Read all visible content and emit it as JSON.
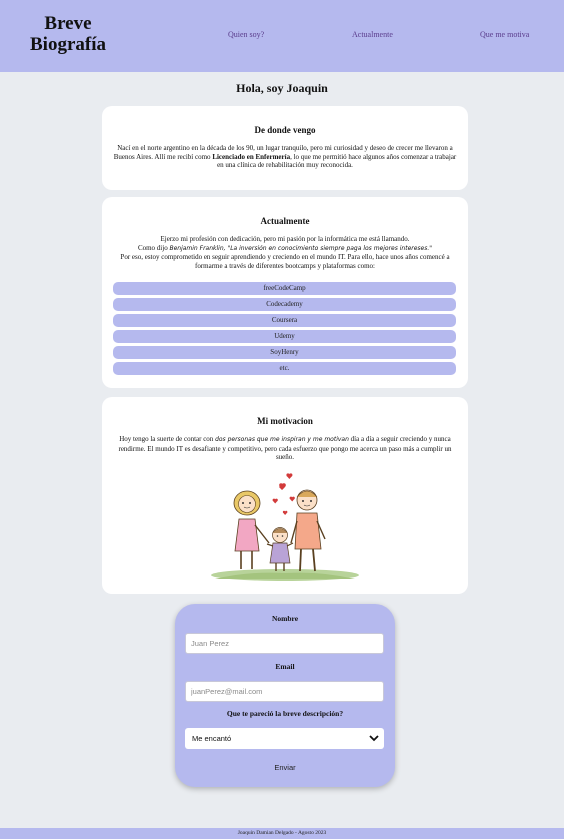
{
  "header": {
    "title": "Breve Biografía",
    "nav": [
      "Quien soy?",
      "Actualmente",
      "Que me motiva"
    ]
  },
  "greeting": "Hola, soy Joaquin",
  "origin": {
    "title": "De donde vengo",
    "text_before": "Nací en el norte argentino en la década de los 90, un lugar tranquilo, pero mi curiosidad y deseo de crecer me llevaron a Buenos Aires. Allí me recibí como ",
    "highlight": "Licenciado en Enfermería",
    "text_after": ", lo que me permitió hace algunos años comenzar a trabajar en una clínica de rehabilitación muy reconocida."
  },
  "current": {
    "title": "Actualmente",
    "line1": "Ejerzo mi profesión con dedicación, pero mi pasión por la informática me está llamando.",
    "quote_intro": "Como dijo ",
    "quote": "Benjamin Franklin, \"La inversión en conocimiento siempre paga los mejores intereses.\"",
    "line3": "Por eso, estoy comprometido en seguir aprendiendo y creciendo en el mundo IT. Para ello, hace unos años comencé a formarme a través de diferentes bootcamps y plataformas como:",
    "platforms": [
      "freeCodeCamp",
      "Codecademy",
      "Coursera",
      "Udemy",
      "SoyHenry",
      "etc."
    ]
  },
  "motivation": {
    "title": "Mi motivacion",
    "text_before": "Hoy tengo la suerte de contar con ",
    "highlight": "dos personas que me inspiran y me motivan",
    "text_after": " día a día a seguir creciendo y nunca rendirme. El mundo IT es desafiante y competitivo, pero cada esfuerzo que pongo me acerca un paso más a cumplir un sueño."
  },
  "form": {
    "name_label": "Nombre",
    "name_placeholder": "Juan Perez",
    "email_label": "Email",
    "email_placeholder": "juanPerez@mail.com",
    "question_label": "Que te pareció la breve descripción?",
    "selected_option": "Me encantó",
    "submit_label": "Enviar"
  },
  "footer": "Joaquin Damian Delgado - Agosto 2023",
  "colors": {
    "accent": "#b5b9ee",
    "background": "#e9ecf0",
    "nav_link": "#5a3c8c"
  }
}
